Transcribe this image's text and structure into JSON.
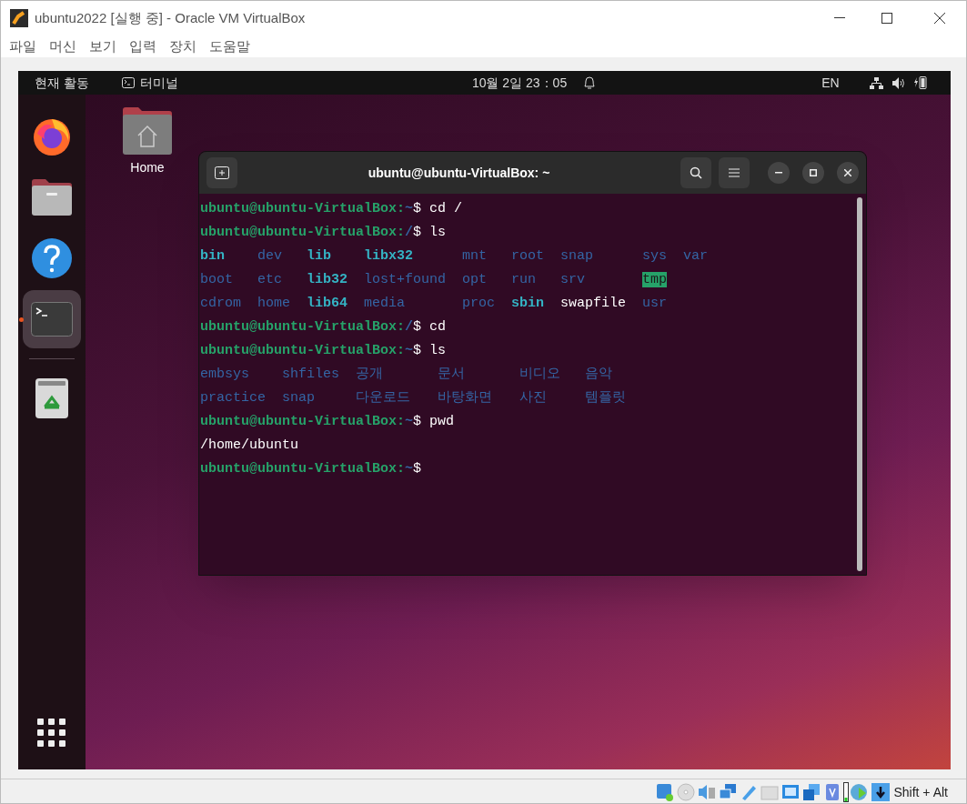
{
  "window": {
    "title": "ubuntu2022 [실행 중] - Oracle VM VirtualBox"
  },
  "menu": [
    "파일",
    "머신",
    "보기",
    "입력",
    "장치",
    "도움말"
  ],
  "top_bar": {
    "activities": "현재 활동",
    "app": "터미널",
    "clock": "10월 2일 23：05",
    "input_source": "EN"
  },
  "dock": {
    "items": [
      {
        "kind": "firefox",
        "active": false
      },
      {
        "kind": "files",
        "active": false
      },
      {
        "kind": "help",
        "active": false
      },
      {
        "kind": "terminal",
        "active": true
      }
    ],
    "trash": {
      "kind": "trash",
      "active": false
    }
  },
  "desktop_icons": [
    {
      "label": "Home"
    }
  ],
  "terminal": {
    "title": "ubuntu@ubuntu-VirtualBox: ~",
    "lines": [
      {
        "kind": "prompt",
        "host": "ubuntu@ubuntu-VirtualBox:",
        "path": "~",
        "rest": "$ cd /"
      },
      {
        "kind": "prompt",
        "host": "ubuntu@ubuntu-VirtualBox:",
        "path": "/",
        "rest": "$ ls"
      },
      {
        "kind": "listing",
        "rows": [
          [
            {
              "text": "bin",
              "kind": "link"
            },
            {
              "text": "dev",
              "kind": "dir"
            },
            {
              "text": "lib",
              "kind": "link"
            },
            {
              "text": "libx32",
              "kind": "link"
            },
            {
              "text": "mnt",
              "kind": "dir"
            },
            {
              "text": "root",
              "kind": "dir"
            },
            {
              "text": "snap",
              "kind": "dir"
            },
            {
              "text": "sys",
              "kind": "dir"
            },
            {
              "text": "var",
              "kind": "dir"
            }
          ],
          [
            {
              "text": "boot",
              "kind": "dir"
            },
            {
              "text": "etc",
              "kind": "dir"
            },
            {
              "text": "lib32",
              "kind": "link"
            },
            {
              "text": "lost+found",
              "kind": "dir"
            },
            {
              "text": "opt",
              "kind": "dir"
            },
            {
              "text": "run",
              "kind": "dir"
            },
            {
              "text": "srv",
              "kind": "dir"
            },
            {
              "text": "tmp",
              "kind": "sticky"
            }
          ],
          [
            {
              "text": "cdrom",
              "kind": "dir"
            },
            {
              "text": "home",
              "kind": "dir"
            },
            {
              "text": "lib64",
              "kind": "link"
            },
            {
              "text": "media",
              "kind": "dir"
            },
            {
              "text": "proc",
              "kind": "dir"
            },
            {
              "text": "sbin",
              "kind": "link"
            },
            {
              "text": "swapfile",
              "kind": "file"
            },
            {
              "text": "usr",
              "kind": "dir"
            }
          ]
        ]
      },
      {
        "kind": "prompt",
        "host": "ubuntu@ubuntu-VirtualBox:",
        "path": "/",
        "rest": "$ cd"
      },
      {
        "kind": "prompt",
        "host": "ubuntu@ubuntu-VirtualBox:",
        "path": "~",
        "rest": "$ ls"
      },
      {
        "kind": "listing",
        "rows": [
          [
            {
              "text": "embsys",
              "kind": "dir"
            },
            {
              "text": "shfiles",
              "kind": "dir"
            },
            {
              "text": "공개",
              "kind": "dir"
            },
            {
              "text": "문서",
              "kind": "dir"
            },
            {
              "text": "비디오",
              "kind": "dir"
            },
            {
              "text": "음악",
              "kind": "dir"
            }
          ],
          [
            {
              "text": "practice",
              "kind": "dir"
            },
            {
              "text": "snap",
              "kind": "dir"
            },
            {
              "text": "다운로드",
              "kind": "dir"
            },
            {
              "text": "바탕화면",
              "kind": "dir"
            },
            {
              "text": "사진",
              "kind": "dir"
            },
            {
              "text": "템플릿",
              "kind": "dir"
            }
          ]
        ]
      },
      {
        "kind": "prompt",
        "host": "ubuntu@ubuntu-VirtualBox:",
        "path": "~",
        "rest": "$ pwd"
      },
      {
        "kind": "output",
        "text": "/home/ubuntu"
      },
      {
        "kind": "prompt",
        "host": "ubuntu@ubuntu-VirtualBox:",
        "path": "~",
        "rest": "$"
      }
    ]
  },
  "status_bar": {
    "host_key": "Shift + Alt"
  }
}
